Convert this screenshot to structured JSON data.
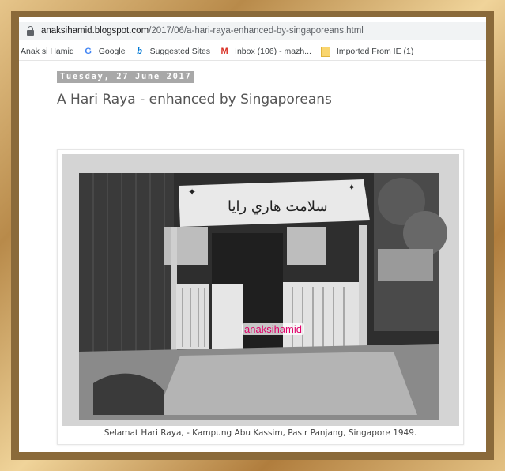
{
  "address_bar": {
    "url_host": "anaksihamid.blogspot.com",
    "url_path": "/2017/06/a-hari-raya-enhanced-by-singaporeans.html"
  },
  "bookmarks": [
    {
      "label": "Anak si Hamid",
      "icon": "none"
    },
    {
      "label": "Google",
      "icon": "google-icon"
    },
    {
      "label": "Suggested Sites",
      "icon": "bing-icon"
    },
    {
      "label": "Inbox (106) - mazh...",
      "icon": "gmail-icon"
    },
    {
      "label": "Imported From IE (1)",
      "icon": "folder-icon"
    }
  ],
  "post": {
    "date": "Tuesday, 27 June 2017",
    "title": "A Hari Raya - enhanced by Singaporeans",
    "photo_watermark": "anaksihamid",
    "photo_caption": "Selamat Hari Raya, - Kampung Abu Kassim, Pasir Panjang, Singapore 1949."
  },
  "colors": {
    "frame": "#c9a46a",
    "date_header_bg": "#a8a8a8",
    "watermark": "#e0006a"
  }
}
